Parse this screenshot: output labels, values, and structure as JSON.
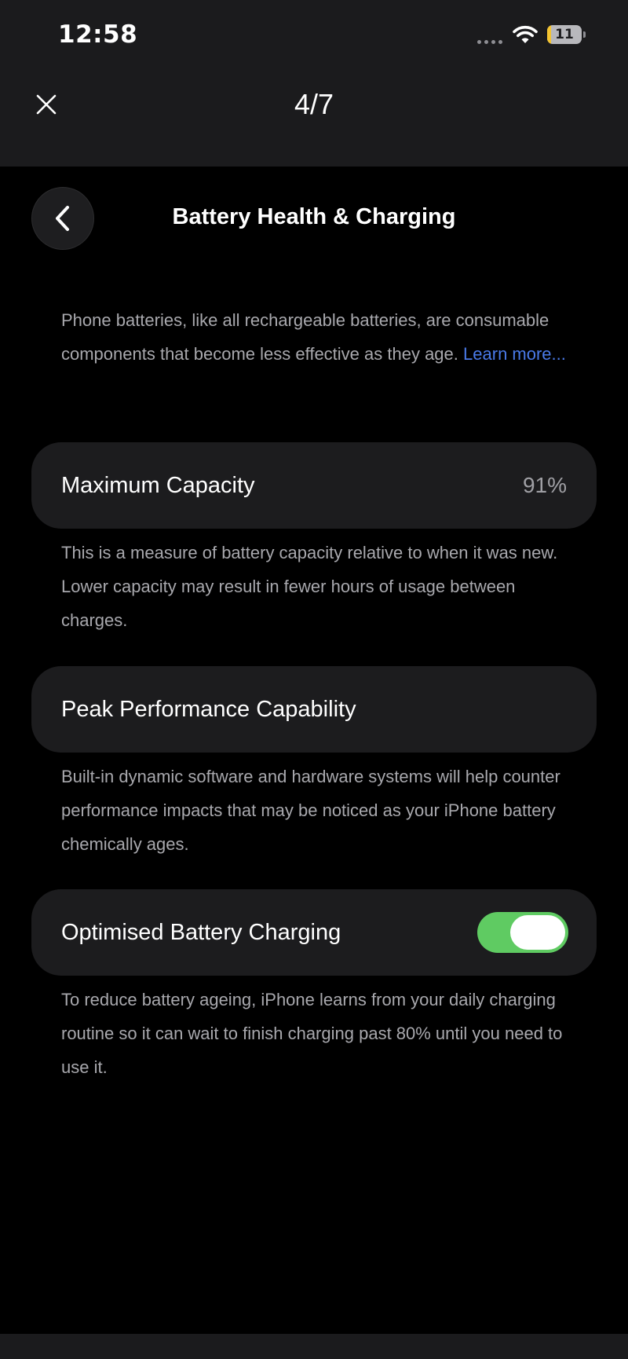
{
  "status_bar": {
    "time": "12:58",
    "battery_level": "11",
    "battery_fraction": 0.11
  },
  "viewer": {
    "page_counter": "4/7"
  },
  "screen": {
    "title": "Battery Health & Charging",
    "intro": {
      "text": "Phone batteries, like all rechargeable batteries, are consumable components that become less effective as they age.",
      "link": "Learn more..."
    },
    "maximum_capacity": {
      "label": "Maximum Capacity",
      "value": "91%",
      "description": "This is a measure of battery capacity relative to when it was new. Lower capacity may result in fewer hours of usage between charges."
    },
    "peak_performance": {
      "label": "Peak Performance Capability",
      "description": "Built-in dynamic software and hardware systems will help counter performance impacts that may be noticed as your iPhone battery chemically ages."
    },
    "optimised_charging": {
      "label": "Optimised Battery Charging",
      "enabled": true,
      "description": "To reduce battery ageing, iPhone learns from your daily charging routine so it can wait to finish charging past 80% until you need to use it."
    }
  },
  "icons": {
    "close": "close-icon",
    "back": "chevron-left-icon",
    "wifi": "wifi-icon",
    "battery": "battery-icon"
  },
  "colors": {
    "link": "#4a7ae8",
    "toggle_on": "#5fcb62",
    "battery_fill": "#f4c430"
  }
}
